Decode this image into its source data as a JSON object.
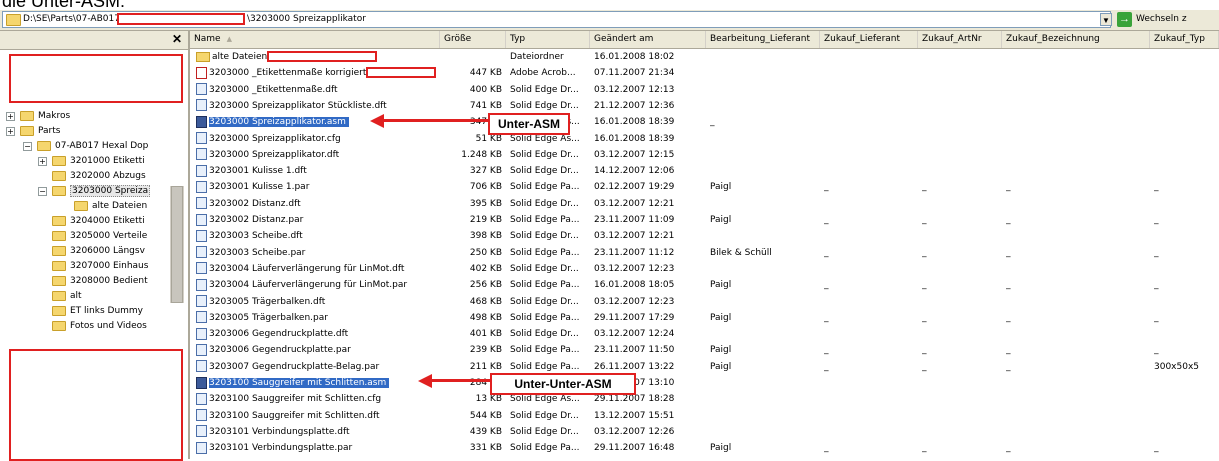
{
  "caption": "die Unter-ASM:",
  "address": {
    "path_prefix": "D:\\SE\\Parts\\07-AB017",
    "path_suffix": "\\3203000 Spreizapplikator",
    "dropdown_icon": "chevron-down-icon",
    "go_label": "Wechseln z"
  },
  "tree": {
    "close_label": "✕",
    "items": [
      {
        "label": "Makros",
        "level": 1,
        "expander": "+"
      },
      {
        "label": "Parts",
        "level": 1,
        "expander": "+"
      },
      {
        "label": "07-AB017 Hexal Dop",
        "level": 2,
        "expander": "−"
      },
      {
        "label": "3201000 Etiketti",
        "level": 3,
        "expander": "+"
      },
      {
        "label": "3202000 Abzugs",
        "level": 3,
        "expander": ""
      },
      {
        "label": "3203000 Spreiza",
        "level": 3,
        "expander": "−",
        "selected": true
      },
      {
        "label": "alte Dateien",
        "level": 4,
        "expander": ""
      },
      {
        "label": "3204000 Etiketti",
        "level": 3,
        "expander": ""
      },
      {
        "label": "3205000 Verteile",
        "level": 3,
        "expander": ""
      },
      {
        "label": "3206000 Längsv",
        "level": 3,
        "expander": ""
      },
      {
        "label": "3207000 Einhaus",
        "level": 3,
        "expander": ""
      },
      {
        "label": "3208000 Bedient",
        "level": 3,
        "expander": ""
      },
      {
        "label": "alt",
        "level": 3,
        "expander": ""
      },
      {
        "label": "ET links Dummy",
        "level": 3,
        "expander": ""
      },
      {
        "label": "Fotos und Videos",
        "level": 3,
        "expander": ""
      }
    ]
  },
  "columns": [
    "Name",
    "Größe",
    "Typ",
    "Geändert am",
    "Bearbeitung_Lieferant",
    "Zukauf_Lieferant",
    "Zukauf_ArtNr",
    "Zukauf_Bezeichnung",
    "Zukauf_Typ"
  ],
  "sort_indicator": "▲",
  "files": [
    {
      "name": "alte Dateien",
      "size": "",
      "type": "Dateiordner",
      "date": "16.01.2008 18:02",
      "lief": "",
      "zl": "",
      "za": "",
      "zb": "",
      "zt": "",
      "icon": "folder",
      "redact": 110
    },
    {
      "name": "3203000 _Etikettenmaße korrigiert",
      "size": "447 KB",
      "type": "Adobe Acrob...",
      "date": "07.11.2007 21:34",
      "lief": "",
      "zl": "",
      "za": "",
      "zb": "",
      "zt": "",
      "icon": "pdf",
      "redact": 70
    },
    {
      "name": "3203000 _Etikettenmaße.dft",
      "size": "400 KB",
      "type": "Solid Edge Dr...",
      "date": "03.12.2007 12:13",
      "lief": "",
      "zl": "",
      "za": "",
      "zb": "",
      "zt": "",
      "icon": "dft"
    },
    {
      "name": "3203000 Spreizapplikator Stückliste.dft",
      "size": "741 KB",
      "type": "Solid Edge Dr...",
      "date": "21.12.2007 12:36",
      "lief": "",
      "zl": "",
      "za": "",
      "zb": "",
      "zt": "",
      "icon": "dft"
    },
    {
      "name": "3203000 Spreizapplikator.asm",
      "size": "347 KB",
      "type": "Solid Edge As...",
      "date": "16.01.2008 18:39",
      "lief": "_",
      "zl": "",
      "za": "",
      "zb": "",
      "zt": "",
      "icon": "asm",
      "selected": true
    },
    {
      "name": "3203000 Spreizapplikator.cfg",
      "size": "51 KB",
      "type": "Solid Edge As...",
      "date": "16.01.2008 18:39",
      "lief": "",
      "zl": "",
      "za": "",
      "zb": "",
      "zt": "",
      "icon": "cfg"
    },
    {
      "name": "3203000 Spreizapplikator.dft",
      "size": "1.248 KB",
      "type": "Solid Edge Dr...",
      "date": "03.12.2007 12:15",
      "lief": "",
      "zl": "",
      "za": "",
      "zb": "",
      "zt": "",
      "icon": "dft"
    },
    {
      "name": "3203001 Kulisse 1.dft",
      "size": "327 KB",
      "type": "Solid Edge Dr...",
      "date": "14.12.2007 12:06",
      "lief": "",
      "zl": "",
      "za": "",
      "zb": "",
      "zt": "",
      "icon": "dft"
    },
    {
      "name": "3203001 Kulisse 1.par",
      "size": "706 KB",
      "type": "Solid Edge Pa...",
      "date": "02.12.2007 19:29",
      "lief": "Paigl",
      "zl": "_",
      "za": "_",
      "zb": "_",
      "zt": "_",
      "icon": "par"
    },
    {
      "name": "3203002 Distanz.dft",
      "size": "395 KB",
      "type": "Solid Edge Dr...",
      "date": "03.12.2007 12:21",
      "lief": "",
      "zl": "",
      "za": "",
      "zb": "",
      "zt": "",
      "icon": "dft"
    },
    {
      "name": "3203002 Distanz.par",
      "size": "219 KB",
      "type": "Solid Edge Pa...",
      "date": "23.11.2007 11:09",
      "lief": "Paigl",
      "zl": "_",
      "za": "_",
      "zb": "_",
      "zt": "_",
      "icon": "par"
    },
    {
      "name": "3203003 Scheibe.dft",
      "size": "398 KB",
      "type": "Solid Edge Dr...",
      "date": "03.12.2007 12:21",
      "lief": "",
      "zl": "",
      "za": "",
      "zb": "",
      "zt": "",
      "icon": "dft"
    },
    {
      "name": "3203003 Scheibe.par",
      "size": "250 KB",
      "type": "Solid Edge Pa...",
      "date": "23.11.2007 11:12",
      "lief": "Bilek & Schüll",
      "zl": "_",
      "za": "_",
      "zb": "_",
      "zt": "_",
      "icon": "par"
    },
    {
      "name": "3203004 Läuferverlängerung für LinMot.dft",
      "size": "402 KB",
      "type": "Solid Edge Dr...",
      "date": "03.12.2007 12:23",
      "lief": "",
      "zl": "",
      "za": "",
      "zb": "",
      "zt": "",
      "icon": "dft"
    },
    {
      "name": "3203004 Läuferverlängerung für LinMot.par",
      "size": "256 KB",
      "type": "Solid Edge Pa...",
      "date": "16.01.2008 18:05",
      "lief": "Paigl",
      "zl": "_",
      "za": "_",
      "zb": "_",
      "zt": "_",
      "icon": "par"
    },
    {
      "name": "3203005 Trägerbalken.dft",
      "size": "468 KB",
      "type": "Solid Edge Dr...",
      "date": "03.12.2007 12:23",
      "lief": "",
      "zl": "",
      "za": "",
      "zb": "",
      "zt": "",
      "icon": "dft"
    },
    {
      "name": "3203005 Trägerbalken.par",
      "size": "498 KB",
      "type": "Solid Edge Pa...",
      "date": "29.11.2007 17:29",
      "lief": "Paigl",
      "zl": "_",
      "za": "_",
      "zb": "_",
      "zt": "_",
      "icon": "par"
    },
    {
      "name": "3203006 Gegendruckplatte.dft",
      "size": "401 KB",
      "type": "Solid Edge Dr...",
      "date": "03.12.2007 12:24",
      "lief": "",
      "zl": "",
      "za": "",
      "zb": "",
      "zt": "",
      "icon": "dft"
    },
    {
      "name": "3203006 Gegendruckplatte.par",
      "size": "239 KB",
      "type": "Solid Edge Pa...",
      "date": "23.11.2007 11:50",
      "lief": "Paigl",
      "zl": "_",
      "za": "_",
      "zb": "_",
      "zt": "_",
      "icon": "par"
    },
    {
      "name": "3203007 Gegendruckplatte-Belag.par",
      "size": "211 KB",
      "type": "Solid Edge Pa...",
      "date": "26.11.2007 13:22",
      "lief": "Paigl",
      "zl": "_",
      "za": "_",
      "zb": "_",
      "zt": "300x50x5",
      "icon": "par"
    },
    {
      "name": "3203100 Sauggreifer mit Schlitten.asm",
      "size": "284 KB",
      "type": "Solid Edge As...",
      "date": "29.11.2007 13:10",
      "lief": "",
      "zl": "",
      "za": "",
      "zb": "",
      "zt": "",
      "icon": "asm",
      "selected": true
    },
    {
      "name": "3203100 Sauggreifer mit Schlitten.cfg",
      "size": "13 KB",
      "type": "Solid Edge As...",
      "date": "29.11.2007 18:28",
      "lief": "",
      "zl": "",
      "za": "",
      "zb": "",
      "zt": "",
      "icon": "cfg"
    },
    {
      "name": "3203100 Sauggreifer mit Schlitten.dft",
      "size": "544 KB",
      "type": "Solid Edge Dr...",
      "date": "13.12.2007 15:51",
      "lief": "",
      "zl": "",
      "za": "",
      "zb": "",
      "zt": "",
      "icon": "dft"
    },
    {
      "name": "3203101 Verbindungsplatte.dft",
      "size": "439 KB",
      "type": "Solid Edge Dr...",
      "date": "03.12.2007 12:26",
      "lief": "",
      "zl": "",
      "za": "",
      "zb": "",
      "zt": "",
      "icon": "dft"
    },
    {
      "name": "3203101 Verbindungsplatte.par",
      "size": "331 KB",
      "type": "Solid Edge Pa...",
      "date": "29.11.2007 16:48",
      "lief": "Paigl",
      "zl": "_",
      "za": "_",
      "zb": "_",
      "zt": "_",
      "icon": "par"
    }
  ],
  "annotations": {
    "unter_asm": "Unter-ASM",
    "unter_unter_asm": "Unter-Unter-ASM",
    "color": "#e02020"
  }
}
